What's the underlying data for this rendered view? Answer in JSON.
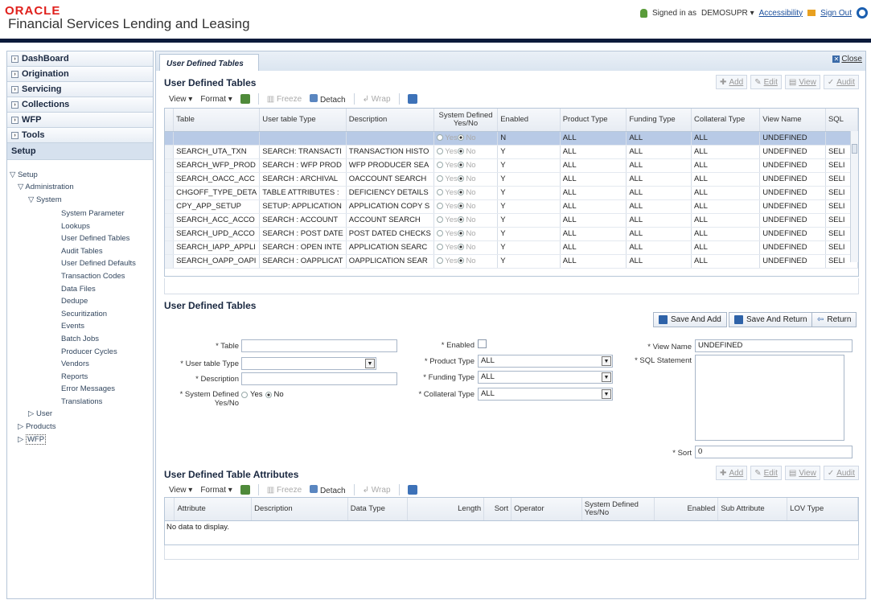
{
  "header": {
    "logo_oracle": "ORACLE",
    "logo_product": "Financial Services Lending and Leasing",
    "signed_in_as": "Signed in as",
    "user": "DEMOSUPR",
    "accessibility": "Accessibility",
    "sign_out": "Sign Out"
  },
  "sidebar": {
    "sections": [
      "DashBoard",
      "Origination",
      "Servicing",
      "Collections",
      "WFP",
      "Tools"
    ],
    "setup_label": "Setup",
    "tree": {
      "setup": "Setup",
      "administration": "Administration",
      "system": "System",
      "system_items": [
        "System Parameter",
        "Lookups",
        "User Defined Tables",
        "Audit Tables",
        "User Defined Defaults",
        "Transaction Codes",
        "Data Files",
        "Dedupe",
        "Securitization",
        "Events",
        "Batch Jobs",
        "Producer Cycles",
        "Vendors",
        "Reports",
        "Error Messages",
        "Translations"
      ],
      "user": "User",
      "products": "Products",
      "wfp": "WFP"
    }
  },
  "tab": {
    "title": "User Defined Tables",
    "close": "Close"
  },
  "top_table": {
    "title": "User Defined Tables",
    "actions": {
      "add": "Add",
      "edit": "Edit",
      "view": "View",
      "audit": "Audit"
    },
    "toolbar": {
      "view": "View",
      "format": "Format",
      "freeze": "Freeze",
      "detach": "Detach",
      "wrap": "Wrap"
    },
    "columns": [
      "Table",
      "User table Type",
      "Description",
      "System Defined Yes/No",
      "Enabled",
      "Product Type",
      "Funding Type",
      "Collateral Type",
      "View Name",
      "SQL"
    ],
    "yes": "Yes",
    "no": "No",
    "rows": [
      [
        "",
        "",
        "",
        "N",
        "ALL",
        "ALL",
        "ALL",
        "UNDEFINED",
        ""
      ],
      [
        "SEARCH_UTA_TXN",
        "SEARCH: TRANSACTI",
        "TRANSACTION HISTO",
        "Y",
        "ALL",
        "ALL",
        "ALL",
        "UNDEFINED",
        "SELI"
      ],
      [
        "SEARCH_WFP_PROD",
        "SEARCH : WFP PROD",
        "WFP PRODUCER SEA",
        "Y",
        "ALL",
        "ALL",
        "ALL",
        "UNDEFINED",
        "SELI"
      ],
      [
        "SEARCH_OACC_ACC",
        "SEARCH : ARCHIVAL",
        "OACCOUNT SEARCH",
        "Y",
        "ALL",
        "ALL",
        "ALL",
        "UNDEFINED",
        "SELI"
      ],
      [
        "CHGOFF_TYPE_DETA",
        "TABLE ATTRIBUTES :",
        "DEFICIENCY DETAILS",
        "Y",
        "ALL",
        "ALL",
        "ALL",
        "UNDEFINED",
        "SELI"
      ],
      [
        "CPY_APP_SETUP",
        "SETUP: APPLICATION",
        "APPLICATION COPY S",
        "Y",
        "ALL",
        "ALL",
        "ALL",
        "UNDEFINED",
        "SELI"
      ],
      [
        "SEARCH_ACC_ACCO",
        "SEARCH : ACCOUNT",
        "ACCOUNT SEARCH",
        "Y",
        "ALL",
        "ALL",
        "ALL",
        "UNDEFINED",
        "SELI"
      ],
      [
        "SEARCH_UPD_ACCO",
        "SEARCH : POST DATE",
        "POST DATED CHECKS",
        "Y",
        "ALL",
        "ALL",
        "ALL",
        "UNDEFINED",
        "SELI"
      ],
      [
        "SEARCH_IAPP_APPLI",
        "SEARCH : OPEN INTE",
        "APPLICATION SEARC",
        "Y",
        "ALL",
        "ALL",
        "ALL",
        "UNDEFINED",
        "SELI"
      ],
      [
        "SEARCH_OAPP_OAPI",
        "SEARCH : OAPPLICAT",
        "OAPPLICATION SEAR",
        "Y",
        "ALL",
        "ALL",
        "ALL",
        "UNDEFINED",
        "SELI"
      ]
    ]
  },
  "form": {
    "title": "User Defined Tables",
    "buttons": {
      "save_and_add": "Save And Add",
      "save_and_return": "Save And Return",
      "return": "Return"
    },
    "labels": {
      "table": "* Table",
      "user_table_type": "* User table Type",
      "description": "* Description",
      "system_defined": "* System Defined Yes/No",
      "enabled": "* Enabled",
      "product_type": "* Product Type",
      "funding_type": "* Funding Type",
      "collateral_type": "* Collateral Type",
      "view_name": "* View Name",
      "sql_statement": "* SQL Statement",
      "sort": "* Sort"
    },
    "values": {
      "product_type": "ALL",
      "funding_type": "ALL",
      "collateral_type": "ALL",
      "view_name": "UNDEFINED",
      "sort": "0",
      "yes": "Yes",
      "no": "No"
    }
  },
  "attr_table": {
    "title": "User Defined Table Attributes",
    "actions": {
      "add": "Add",
      "edit": "Edit",
      "view": "View",
      "audit": "Audit"
    },
    "toolbar": {
      "view": "View",
      "format": "Format",
      "freeze": "Freeze",
      "detach": "Detach",
      "wrap": "Wrap"
    },
    "columns": [
      "Attribute",
      "Description",
      "Data Type",
      "Length",
      "Sort",
      "Operator",
      "System Defined Yes/No",
      "Enabled",
      "Sub Attribute",
      "LOV Type"
    ],
    "empty": "No data to display."
  },
  "colors": {
    "oracle_red": "#e0201c",
    "band": "#0b1a3a",
    "selected_row": "#b8cae6",
    "link": "#1b4f9c"
  }
}
